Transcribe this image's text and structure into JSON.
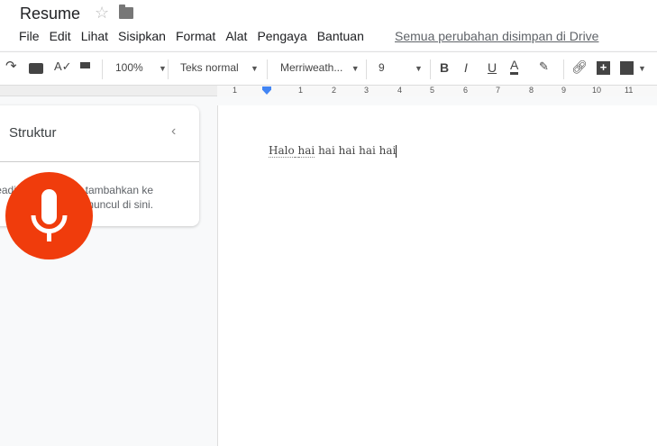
{
  "title": "Resume",
  "menu": [
    "File",
    "Edit",
    "Lihat",
    "Sisipkan",
    "Format",
    "Alat",
    "Pengaya",
    "Bantuan"
  ],
  "saved_status": "Semua perubahan disimpan di Drive",
  "toolbar": {
    "zoom": "100%",
    "style": "Teks normal",
    "font": "Merriweath...",
    "size": "9"
  },
  "ruler": [
    "1",
    "1",
    "2",
    "3",
    "4",
    "5",
    "6",
    "7",
    "8",
    "9",
    "10",
    "11"
  ],
  "outline": {
    "title": "Struktur",
    "empty_text": "Heading yang Anda tambahkan ke dokumen akan muncul di sini."
  },
  "document": {
    "first_word": "Halo",
    "first_word_suggest": "hai",
    "rest": " hai hai hai hai"
  },
  "colors": {
    "mic": "#f03c0c",
    "accent": "#4285f4"
  }
}
